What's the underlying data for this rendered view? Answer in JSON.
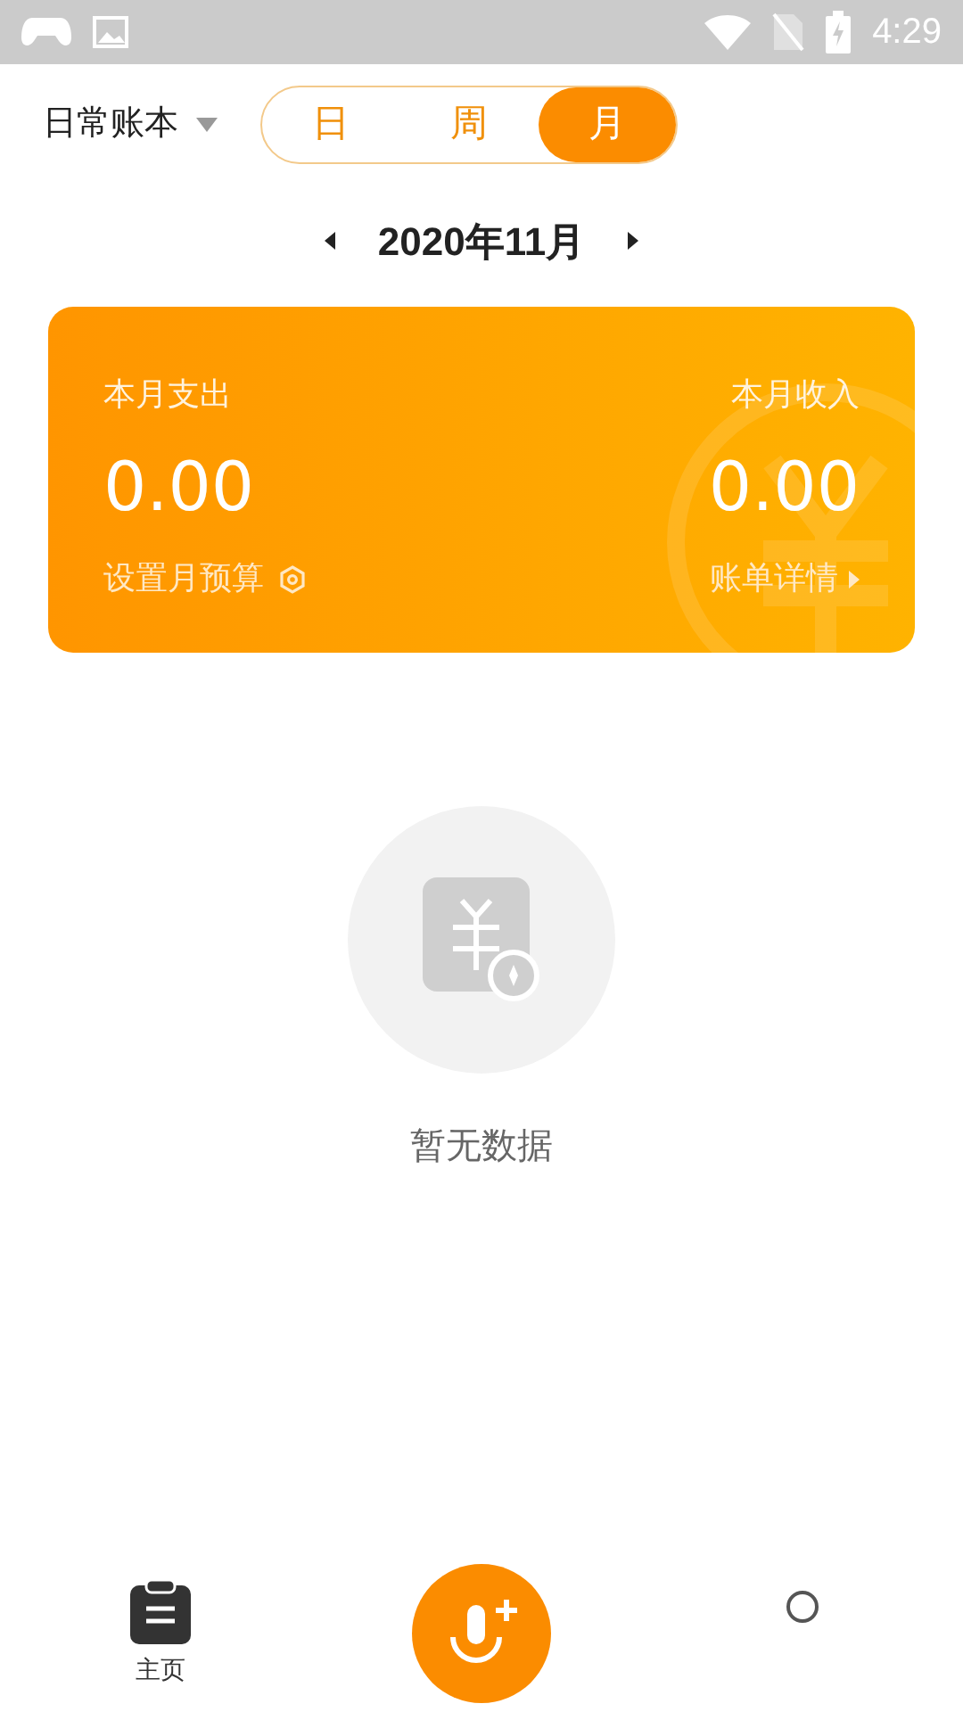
{
  "status_bar": {
    "time": "4:29"
  },
  "header": {
    "book": "日常账本",
    "tabs": [
      {
        "label": "日",
        "selected": false
      },
      {
        "label": "周",
        "selected": false
      },
      {
        "label": "月",
        "selected": true
      }
    ]
  },
  "period": {
    "label": "2020年11月"
  },
  "summary": {
    "expense_label": "本月支出",
    "expense": "0.00",
    "income_label": "本月收入",
    "income": "0.00",
    "budget_link": "设置月预算",
    "details_link": "账单详情"
  },
  "empty_state": {
    "message": "暂无数据"
  },
  "bottom_nav": {
    "home_label": "主页"
  }
}
